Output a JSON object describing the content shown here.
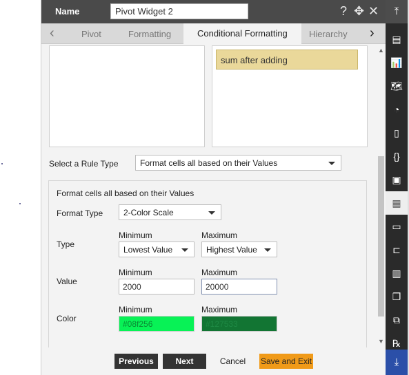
{
  "titlebar": {
    "name_label": "Name",
    "name_value": "Pivot Widget 2",
    "help_icon": "?",
    "move_icon": "✥",
    "close_icon": "✕"
  },
  "tabs": {
    "prev_icon": "‹",
    "next_icon": "›",
    "items": [
      "Pivot",
      "Formatting",
      "Conditional Formatting",
      "Hierarchy"
    ],
    "active": "Conditional Formatting"
  },
  "rules": {
    "selected_rule": "sum after adding"
  },
  "rule_type": {
    "label": "Select a Rule Type",
    "value": "Format cells all based on their Values"
  },
  "section": {
    "heading": "Format cells all based on their Values",
    "format_type_label": "Format Type",
    "format_type_value": "2-Color Scale",
    "type_label": "Type",
    "type_min_header": "Minimum",
    "type_max_header": "Maximum",
    "type_min_value": "Lowest Value",
    "type_max_value": "Highest Value",
    "value_label": "Value",
    "value_min_header": "Minimum",
    "value_max_header": "Maximum",
    "value_min": "2000",
    "value_max": "20000",
    "color_label": "Color",
    "color_min_header": "Minimum",
    "color_max_header": "Maximum",
    "color_min": "#08f256",
    "color_max": "#127533"
  },
  "footer": {
    "previous": "Previous",
    "next": "Next",
    "cancel": "Cancel",
    "save_exit": "Save and Exit"
  },
  "colors": {
    "titlebar": "#4a4a4a",
    "save_button": "#f09a18",
    "rule_highlight": "#ead89a",
    "right_bar": "#2a2a2a",
    "right_bar_bottom": "#2b4fa8"
  },
  "right_toolbar": {
    "top_icon": "collapse-up-icon",
    "bottom_icon": "collapse-down-icon",
    "icons": [
      "table-icon",
      "chart-icon",
      "map-icon",
      "pie-report-icon",
      "document-icon",
      "code-braces-icon",
      "image-icon",
      "pivot-icon",
      "report-icon",
      "hierarchy-icon",
      "bar-chart-icon",
      "copy-icon",
      "cubes-icon",
      "rx-icon"
    ],
    "active_index": 7
  }
}
